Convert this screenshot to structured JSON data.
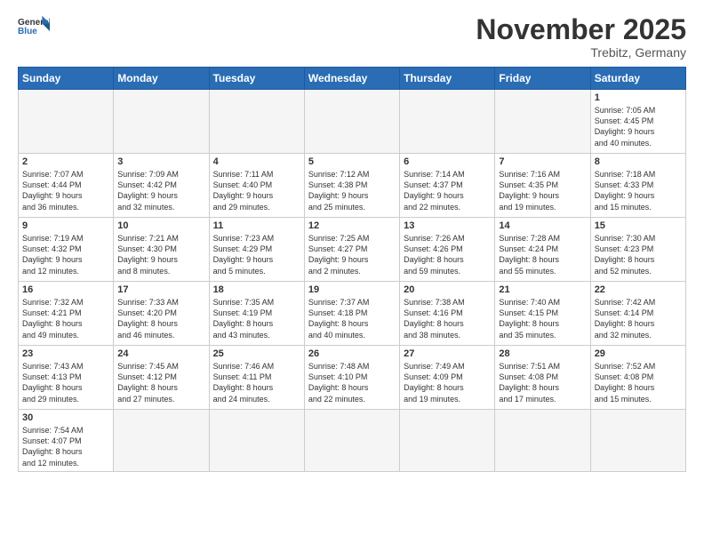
{
  "header": {
    "logo_general": "General",
    "logo_blue": "Blue",
    "month_title": "November 2025",
    "location": "Trebitz, Germany"
  },
  "days_of_week": [
    "Sunday",
    "Monday",
    "Tuesday",
    "Wednesday",
    "Thursday",
    "Friday",
    "Saturday"
  ],
  "weeks": [
    [
      {
        "day": "",
        "info": ""
      },
      {
        "day": "",
        "info": ""
      },
      {
        "day": "",
        "info": ""
      },
      {
        "day": "",
        "info": ""
      },
      {
        "day": "",
        "info": ""
      },
      {
        "day": "",
        "info": ""
      },
      {
        "day": "1",
        "info": "Sunrise: 7:05 AM\nSunset: 4:45 PM\nDaylight: 9 hours\nand 40 minutes."
      }
    ],
    [
      {
        "day": "2",
        "info": "Sunrise: 7:07 AM\nSunset: 4:44 PM\nDaylight: 9 hours\nand 36 minutes."
      },
      {
        "day": "3",
        "info": "Sunrise: 7:09 AM\nSunset: 4:42 PM\nDaylight: 9 hours\nand 32 minutes."
      },
      {
        "day": "4",
        "info": "Sunrise: 7:11 AM\nSunset: 4:40 PM\nDaylight: 9 hours\nand 29 minutes."
      },
      {
        "day": "5",
        "info": "Sunrise: 7:12 AM\nSunset: 4:38 PM\nDaylight: 9 hours\nand 25 minutes."
      },
      {
        "day": "6",
        "info": "Sunrise: 7:14 AM\nSunset: 4:37 PM\nDaylight: 9 hours\nand 22 minutes."
      },
      {
        "day": "7",
        "info": "Sunrise: 7:16 AM\nSunset: 4:35 PM\nDaylight: 9 hours\nand 19 minutes."
      },
      {
        "day": "8",
        "info": "Sunrise: 7:18 AM\nSunset: 4:33 PM\nDaylight: 9 hours\nand 15 minutes."
      }
    ],
    [
      {
        "day": "9",
        "info": "Sunrise: 7:19 AM\nSunset: 4:32 PM\nDaylight: 9 hours\nand 12 minutes."
      },
      {
        "day": "10",
        "info": "Sunrise: 7:21 AM\nSunset: 4:30 PM\nDaylight: 9 hours\nand 8 minutes."
      },
      {
        "day": "11",
        "info": "Sunrise: 7:23 AM\nSunset: 4:29 PM\nDaylight: 9 hours\nand 5 minutes."
      },
      {
        "day": "12",
        "info": "Sunrise: 7:25 AM\nSunset: 4:27 PM\nDaylight: 9 hours\nand 2 minutes."
      },
      {
        "day": "13",
        "info": "Sunrise: 7:26 AM\nSunset: 4:26 PM\nDaylight: 8 hours\nand 59 minutes."
      },
      {
        "day": "14",
        "info": "Sunrise: 7:28 AM\nSunset: 4:24 PM\nDaylight: 8 hours\nand 55 minutes."
      },
      {
        "day": "15",
        "info": "Sunrise: 7:30 AM\nSunset: 4:23 PM\nDaylight: 8 hours\nand 52 minutes."
      }
    ],
    [
      {
        "day": "16",
        "info": "Sunrise: 7:32 AM\nSunset: 4:21 PM\nDaylight: 8 hours\nand 49 minutes."
      },
      {
        "day": "17",
        "info": "Sunrise: 7:33 AM\nSunset: 4:20 PM\nDaylight: 8 hours\nand 46 minutes."
      },
      {
        "day": "18",
        "info": "Sunrise: 7:35 AM\nSunset: 4:19 PM\nDaylight: 8 hours\nand 43 minutes."
      },
      {
        "day": "19",
        "info": "Sunrise: 7:37 AM\nSunset: 4:18 PM\nDaylight: 8 hours\nand 40 minutes."
      },
      {
        "day": "20",
        "info": "Sunrise: 7:38 AM\nSunset: 4:16 PM\nDaylight: 8 hours\nand 38 minutes."
      },
      {
        "day": "21",
        "info": "Sunrise: 7:40 AM\nSunset: 4:15 PM\nDaylight: 8 hours\nand 35 minutes."
      },
      {
        "day": "22",
        "info": "Sunrise: 7:42 AM\nSunset: 4:14 PM\nDaylight: 8 hours\nand 32 minutes."
      }
    ],
    [
      {
        "day": "23",
        "info": "Sunrise: 7:43 AM\nSunset: 4:13 PM\nDaylight: 8 hours\nand 29 minutes."
      },
      {
        "day": "24",
        "info": "Sunrise: 7:45 AM\nSunset: 4:12 PM\nDaylight: 8 hours\nand 27 minutes."
      },
      {
        "day": "25",
        "info": "Sunrise: 7:46 AM\nSunset: 4:11 PM\nDaylight: 8 hours\nand 24 minutes."
      },
      {
        "day": "26",
        "info": "Sunrise: 7:48 AM\nSunset: 4:10 PM\nDaylight: 8 hours\nand 22 minutes."
      },
      {
        "day": "27",
        "info": "Sunrise: 7:49 AM\nSunset: 4:09 PM\nDaylight: 8 hours\nand 19 minutes."
      },
      {
        "day": "28",
        "info": "Sunrise: 7:51 AM\nSunset: 4:08 PM\nDaylight: 8 hours\nand 17 minutes."
      },
      {
        "day": "29",
        "info": "Sunrise: 7:52 AM\nSunset: 4:08 PM\nDaylight: 8 hours\nand 15 minutes."
      }
    ],
    [
      {
        "day": "30",
        "info": "Sunrise: 7:54 AM\nSunset: 4:07 PM\nDaylight: 8 hours\nand 12 minutes."
      },
      {
        "day": "",
        "info": ""
      },
      {
        "day": "",
        "info": ""
      },
      {
        "day": "",
        "info": ""
      },
      {
        "day": "",
        "info": ""
      },
      {
        "day": "",
        "info": ""
      },
      {
        "day": "",
        "info": ""
      }
    ]
  ]
}
